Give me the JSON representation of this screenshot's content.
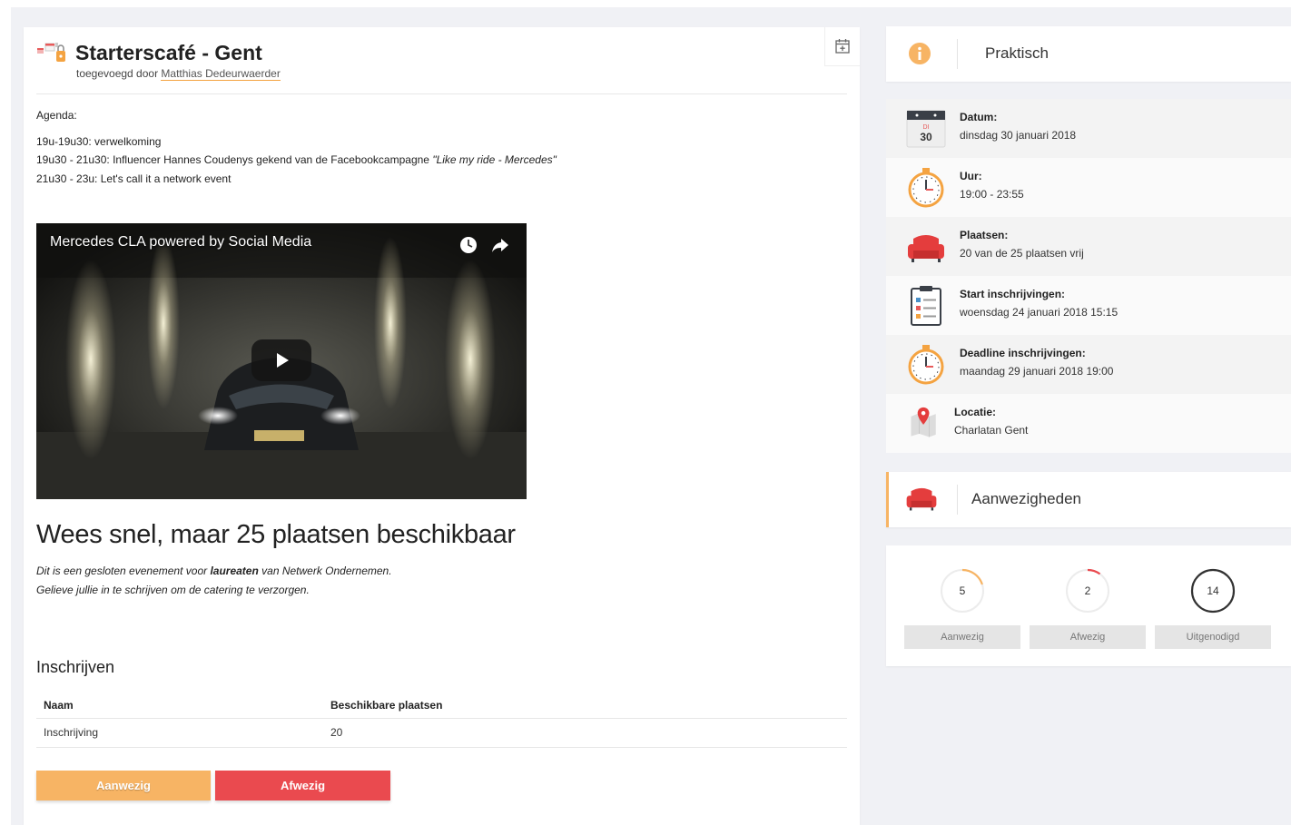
{
  "event": {
    "title": "Starterscafé - Gent",
    "added_by_prefix": "toegevoegd door",
    "added_by_name": "Matthias Dedeurwaerder"
  },
  "agenda": {
    "heading": "Agenda:",
    "lines": [
      {
        "text": "19u-19u30: verwelkoming",
        "italic": ""
      },
      {
        "text": "19u30 - 21u30: Influencer Hannes Coudenys gekend van de Facebookcampagne ",
        "italic": "\"Like my ride - Mercedes\""
      },
      {
        "text": "21u30 - 23u: Let's call it a network event",
        "italic": ""
      }
    ]
  },
  "video": {
    "title": "Mercedes CLA powered by Social Media"
  },
  "promo": {
    "heading": "Wees snel, maar 25 plaatsen beschikbaar",
    "line1_a": "Dit is een gesloten evenement voor ",
    "line1_b": "laureaten",
    "line1_c": " van Netwerk Ondernemen.",
    "line2": "Gelieve jullie in te schrijven om de catering te verzorgen."
  },
  "registration": {
    "title": "Inschrijven",
    "columns": [
      "Naam",
      "Beschikbare plaatsen"
    ],
    "rows": [
      [
        "Inschrijving",
        "20"
      ]
    ]
  },
  "buttons": {
    "present": "Aanwezig",
    "absent": "Afwezig"
  },
  "practical": {
    "header": "Praktisch",
    "items": [
      {
        "key": "Datum:",
        "value": "dinsdag 30 januari 2018",
        "icon": "calendar-icon",
        "cal_day": "DI",
        "cal_num": "30"
      },
      {
        "key": "Uur:",
        "value": "19:00 - 23:55",
        "icon": "stopwatch-icon"
      },
      {
        "key": "Plaatsen:",
        "value": "20 van de 25 plaatsen vrij",
        "icon": "sofa-icon"
      },
      {
        "key": "Start inschrijvingen:",
        "value": "woensdag 24 januari 2018 15:15",
        "icon": "checklist-icon"
      },
      {
        "key": "Deadline inschrijvingen:",
        "value": "maandag 29 januari 2018 19:00",
        "icon": "stopwatch-icon"
      },
      {
        "key": "Locatie:",
        "value": "Charlatan Gent",
        "icon": "map-pin-icon"
      }
    ]
  },
  "attendance": {
    "header": "Aanwezigheden",
    "stats": [
      {
        "label": "Aanwezig",
        "value": "5",
        "fraction": 0.2,
        "color": "#f7b464"
      },
      {
        "label": "Afwezig",
        "value": "2",
        "fraction": 0.1,
        "color": "#ea4a4f"
      },
      {
        "label": "Uitgenodigd",
        "value": "14",
        "fraction": 1.0,
        "color": "#333333"
      }
    ]
  },
  "colors": {
    "accent": "#f7b464",
    "danger": "#ea4a4f"
  }
}
